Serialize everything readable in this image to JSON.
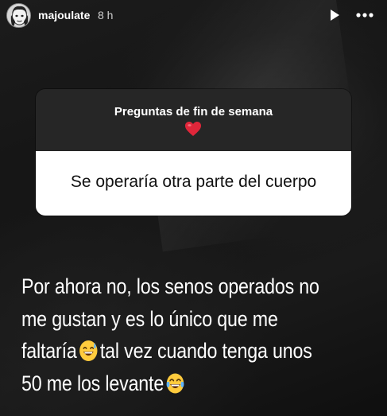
{
  "header": {
    "username": "majoulate",
    "time": "8 h",
    "avatar_icon": "profile-avatar",
    "play_icon": "play-icon",
    "more_icon": "more-dots-icon"
  },
  "question_sticker": {
    "title": "Preguntas de fin de semana",
    "title_icon": "heart-emoji",
    "question": "Se operaría otra parte del cuerpo"
  },
  "answer": {
    "line1": "Por ahora no, los senos operados no",
    "line2": "me gustan y es lo único que me",
    "line3_before": "faltaría",
    "line3_emoji": "grinning-sweat-emoji",
    "line3_after": "tal vez cuando tenga unos",
    "line4_before": "50 me los levante",
    "line4_emoji": "tears-of-joy-emoji"
  },
  "colors": {
    "background": "#141414",
    "card_header": "#262626",
    "card_body": "#ffffff",
    "heart": "#e0263a",
    "text": "#ffffff"
  }
}
